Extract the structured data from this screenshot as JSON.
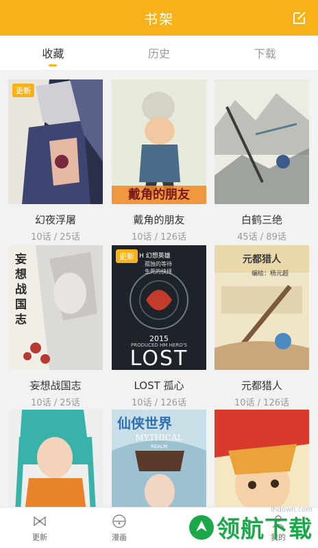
{
  "header": {
    "title": "书架"
  },
  "tabs": [
    {
      "label": "收藏",
      "active": true
    },
    {
      "label": "历史",
      "active": false
    },
    {
      "label": "下载",
      "active": false
    }
  ],
  "comics": [
    {
      "title": "幻夜浮屠",
      "progress": "10话 / 25话",
      "badge": "更新"
    },
    {
      "title": "戴角的朋友",
      "progress": "10话 / 126话",
      "badge": ""
    },
    {
      "title": "白鹤三绝",
      "progress": "45话 / 89话",
      "badge": ""
    },
    {
      "title": "妄想战国志",
      "progress": "10话 / 25话",
      "badge": ""
    },
    {
      "title": "LOST 孤心",
      "progress": "10话 / 126话",
      "badge": "更新"
    },
    {
      "title": "元都猎人",
      "progress": "10话 / 126话",
      "badge": ""
    },
    {
      "title": "",
      "progress": "",
      "badge": ""
    },
    {
      "title": "",
      "progress": "",
      "badge": ""
    },
    {
      "title": "",
      "progress": "",
      "badge": ""
    }
  ],
  "covers": {
    "c2_text": "戴角的朋友",
    "c4_text": "妄想战国志",
    "c5_year": "2015",
    "c5_produced": "PRODUCED HM HERO'S",
    "c5_big": "LOST",
    "c5_logo": "H 幻想英雄",
    "c5_tag1": "孤独的等待",
    "c5_tag2": "生死的抉择",
    "c6_title": "元都猎人",
    "c6_author": "编绘：杨元超",
    "c8_title": "仙侠世界",
    "c8_sub": "MYTHICAL",
    "c8_sub2": "REALM"
  },
  "bottom_nav": [
    {
      "label": "更新",
      "icon": "bow-icon"
    },
    {
      "label": "漫画",
      "icon": "bell-icon"
    },
    {
      "label": "",
      "icon": "bookshelf-icon"
    },
    {
      "label": "我的",
      "icon": "user-icon"
    }
  ],
  "watermark": {
    "text": "领航下载",
    "url": "lhdown.com"
  },
  "colors": {
    "accent": "#f7b21b",
    "text": "#333333",
    "muted": "#999999",
    "watermark": "#1ba84a"
  }
}
